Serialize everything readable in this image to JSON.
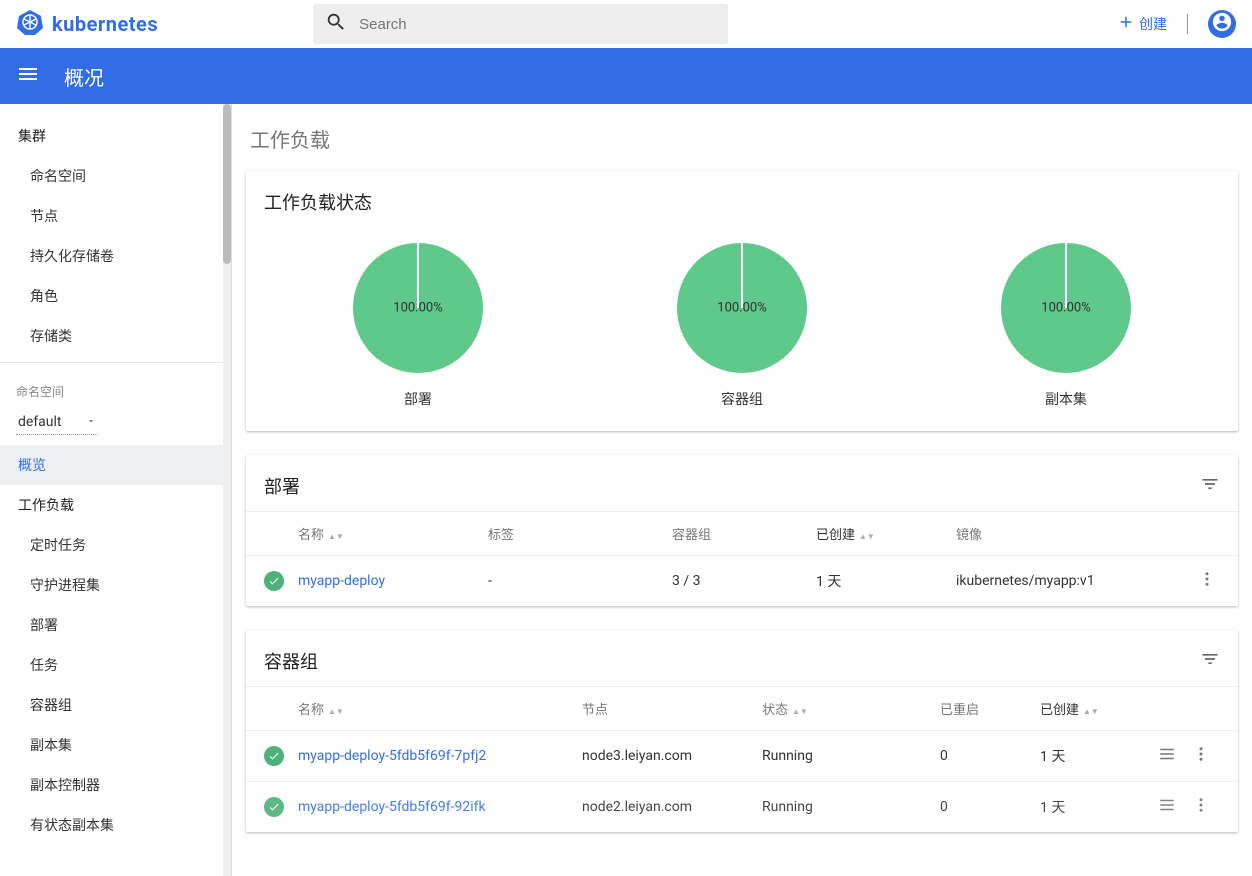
{
  "header": {
    "brand": "kubernetes",
    "search_placeholder": "Search",
    "create_label": "创建"
  },
  "nav": {
    "title": "概况"
  },
  "sidebar": {
    "cluster_label": "集群",
    "cluster_items": [
      "命名空间",
      "节点",
      "持久化存储卷",
      "角色",
      "存储类"
    ],
    "ns_label": "命名空间",
    "ns_selected": "default",
    "overview": "概览",
    "workloads_label": "工作负载",
    "workload_items": [
      "定时任务",
      "守护进程集",
      "部署",
      "任务",
      "容器组",
      "副本集",
      "副本控制器",
      "有状态副本集"
    ]
  },
  "main": {
    "section_title": "工作负载",
    "status_card_title": "工作负载状态"
  },
  "chart_data": [
    {
      "type": "pie",
      "title": "部署",
      "values": [
        100.0
      ],
      "labels": [
        "100.00%"
      ],
      "colors": [
        "#5ec98a"
      ]
    },
    {
      "type": "pie",
      "title": "容器组",
      "values": [
        100.0
      ],
      "labels": [
        "100.00%"
      ],
      "colors": [
        "#5ec98a"
      ]
    },
    {
      "type": "pie",
      "title": "副本集",
      "values": [
        100.0
      ],
      "labels": [
        "100.00%"
      ],
      "colors": [
        "#5ec98a"
      ]
    }
  ],
  "deployments": {
    "title": "部署",
    "columns": {
      "name": "名称",
      "labels": "标签",
      "pods": "容器组",
      "created": "已创建",
      "images": "镜像"
    },
    "rows": [
      {
        "name": "myapp-deploy",
        "labels": "-",
        "pods": "3 / 3",
        "created": "1 天",
        "images": "ikubernetes/myapp:v1"
      }
    ]
  },
  "pods": {
    "title": "容器组",
    "columns": {
      "name": "名称",
      "node": "节点",
      "status": "状态",
      "restarts": "已重启",
      "created": "已创建"
    },
    "rows": [
      {
        "name": "myapp-deploy-5fdb5f69f-7pfj2",
        "node": "node3.leiyan.com",
        "status": "Running",
        "restarts": "0",
        "created": "1 天"
      },
      {
        "name": "myapp-deploy-5fdb5f69f-92ifk",
        "node": "node2.leiyan.com",
        "status": "Running",
        "restarts": "0",
        "created": "1 天"
      }
    ]
  }
}
